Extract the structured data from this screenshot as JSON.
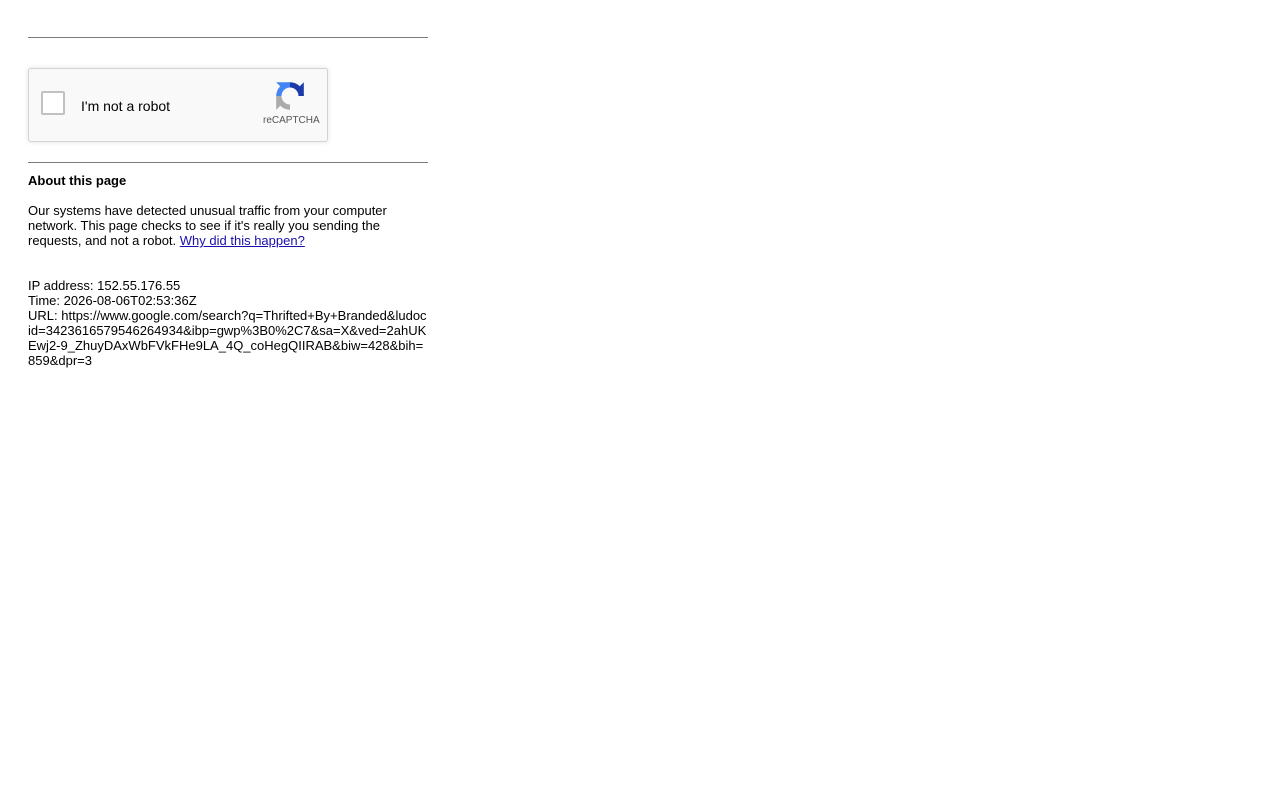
{
  "captcha": {
    "checkbox_label": "I'm not a robot",
    "brand": "reCAPTCHA",
    "logo_icon": "recaptcha-logo-icon"
  },
  "about": {
    "title": "About this page",
    "text": "Our systems have detected unusual traffic from your computer network. This page checks to see if it's really you sending the requests, and not a robot.",
    "link_text": "Why did this happen?"
  },
  "info": {
    "ip_label": "IP address:",
    "ip_value": "152.55.176.55",
    "time_label": "Time:",
    "time_value": "2026-08-06T02:53:36Z",
    "url_label": "URL:",
    "url_value": "https://www.google.com/search?q=Thrifted+By+Branded&ludocid=3423616579546264934&ibp=gwp%3B0%2C7&sa=X&ved=2ahUKEwj2-9_ZhuyDAxWbFVkFHe9LA_4Q_coHegQIIRAB&biw=428&bih=859&dpr=3"
  },
  "colors": {
    "link": "#1a0dab",
    "divider": "#7a7a7a",
    "captcha_bg": "#f9f9f9",
    "recaptcha_blue_dark": "#1c3aa9",
    "recaptcha_blue": "#4285f4",
    "recaptcha_gray": "#ababab"
  }
}
